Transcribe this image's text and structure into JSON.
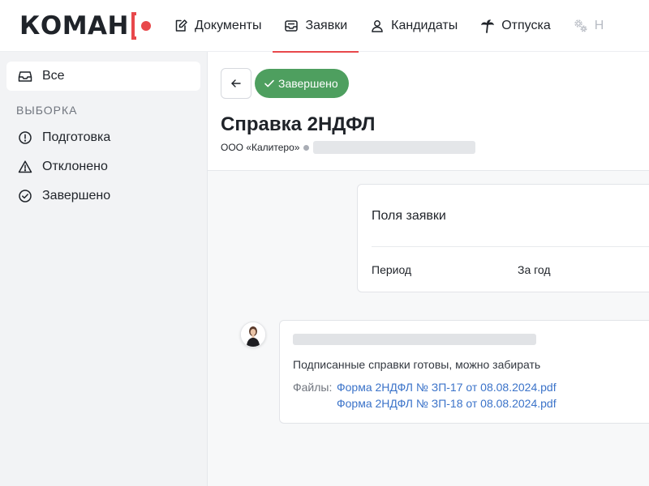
{
  "app": {
    "logo_text": "КОМАН",
    "accent_color": "#e8484b"
  },
  "nav": {
    "tabs": [
      {
        "label": "Документы",
        "icon": "document-edit-icon"
      },
      {
        "label": "Заявки",
        "icon": "inbox-icon",
        "active": true
      },
      {
        "label": "Кандидаты",
        "icon": "person-icon"
      },
      {
        "label": "Отпуска",
        "icon": "palm-tree-icon"
      },
      {
        "label": "Н",
        "icon": "gears-icon"
      }
    ]
  },
  "sidebar": {
    "all_label": "Все",
    "section_title": "ВЫБОРКА",
    "items": [
      {
        "label": "Подготовка",
        "icon": "alert-circle-icon"
      },
      {
        "label": "Отклонено",
        "icon": "warning-triangle-icon"
      },
      {
        "label": "Завершено",
        "icon": "check-circle-icon"
      }
    ]
  },
  "request": {
    "status_label": "Завершено",
    "status_color": "#4e9f5f",
    "title": "Справка 2НДФЛ",
    "company": "ООО «Калитеро»"
  },
  "fields_card": {
    "title": "Поля заявки",
    "fields": [
      {
        "label": "Период",
        "value": "За год"
      }
    ]
  },
  "comment": {
    "text": "Подписанные справки готовы, можно забирать",
    "files_label": "Файлы:",
    "files": [
      "Форма 2НДФЛ № ЗП-17 от 08.08.2024.pdf",
      "Форма 2НДФЛ № ЗП-18 от 08.08.2024.pdf"
    ],
    "link_color": "#3b73c9"
  }
}
